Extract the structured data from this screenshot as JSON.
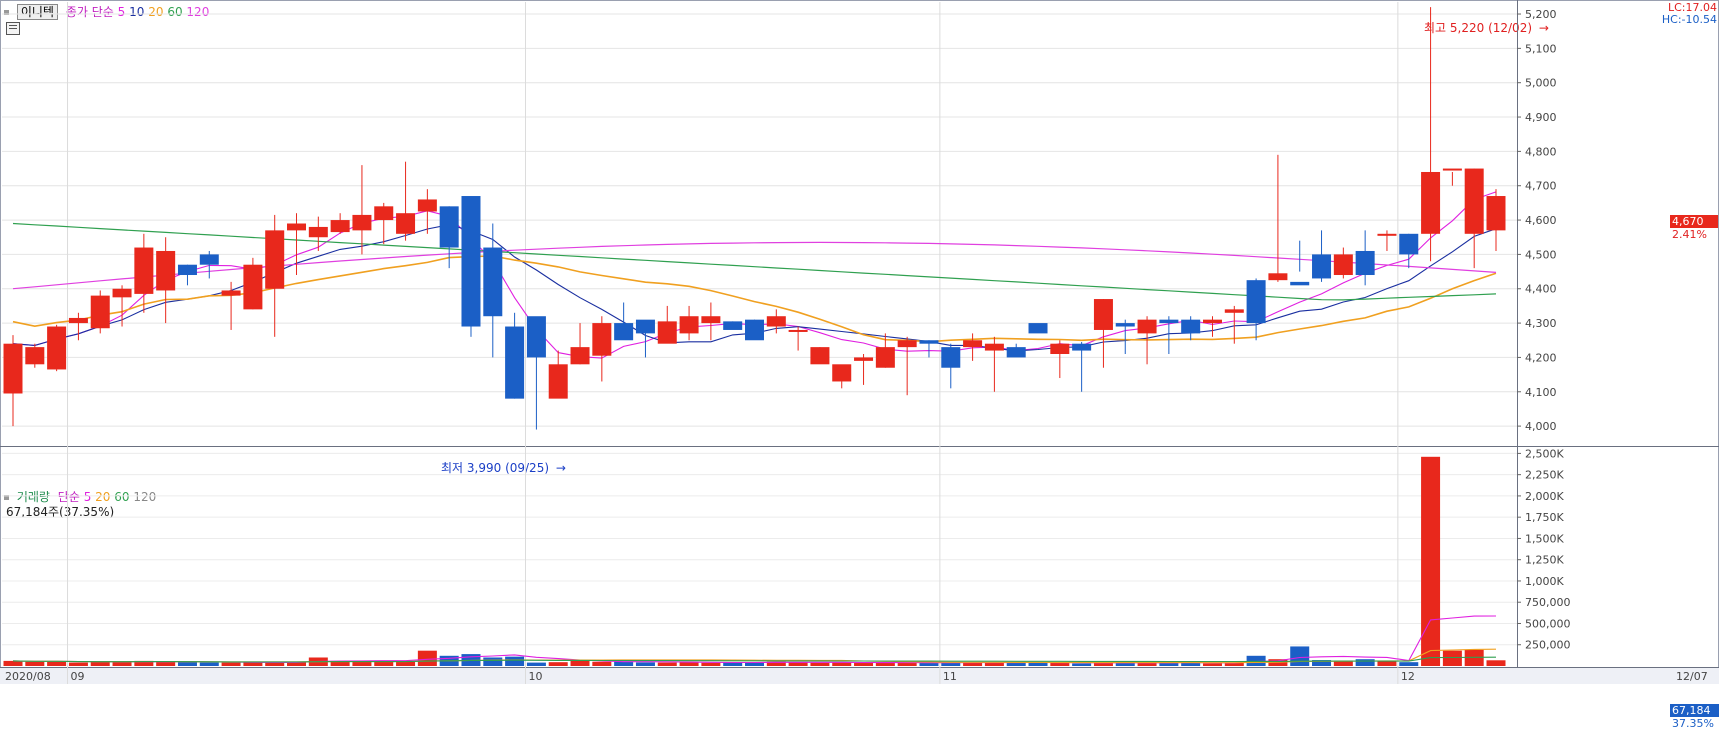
{
  "header": {
    "stock_name": "이니텍",
    "price_label": "종가",
    "ma_label": "단순",
    "ma_periods": [
      "5",
      "10",
      "20",
      "60",
      "120"
    ],
    "lc": "LC:17.04",
    "hc": "HC:-10.54"
  },
  "volume_header": {
    "label": "거래량",
    "ma_label": "단순",
    "ma_periods": [
      "5",
      "20",
      "60",
      "120"
    ],
    "current": "67,184주(37.35%)"
  },
  "annotations": {
    "high": "최고 5,220 (12/02)",
    "low": "최저 3,990 (09/25)"
  },
  "price_badge": {
    "value": "4,670",
    "change": "2.41%"
  },
  "volume_badge": {
    "value": "67,184",
    "ratio": "37.35%"
  },
  "x_labels": [
    "2020/08",
    "09",
    "10",
    "11",
    "12",
    "12/07"
  ],
  "colors": {
    "up": "#e8281c",
    "down": "#1b5fc6",
    "ma5": "#e020e0",
    "ma10": "#1a2fa0",
    "ma20": "#f0a020",
    "ma60": "#30a050",
    "ma120": "#e040e0"
  },
  "chart_data": [
    {
      "type": "candlestick",
      "title": "이니텍",
      "y_ticks": [
        "4,000",
        "4,100",
        "4,200",
        "4,300",
        "4,400",
        "4,500",
        "4,600",
        "4,700",
        "4,800",
        "4,900",
        "5,000",
        "5,100",
        "5,200"
      ],
      "ylim": [
        3945,
        5235
      ],
      "dates": [
        "08/27",
        "08/28",
        "08/31",
        "09/01",
        "09/02",
        "09/03",
        "09/04",
        "09/07",
        "09/08",
        "09/09",
        "09/10",
        "09/11",
        "09/14",
        "09/15",
        "09/16",
        "09/17",
        "09/18",
        "09/21",
        "09/22",
        "09/23",
        "09/24",
        "09/25",
        "09/28",
        "09/29",
        "10/05",
        "10/06",
        "10/07",
        "10/08",
        "10/12",
        "10/13",
        "10/14",
        "10/15",
        "10/16",
        "10/19",
        "10/20",
        "10/21",
        "10/22",
        "10/23",
        "10/26",
        "10/27",
        "10/28",
        "10/29",
        "10/30",
        "11/02",
        "11/03",
        "11/04",
        "11/05",
        "11/06",
        "11/09",
        "11/10",
        "11/11",
        "11/12",
        "11/13",
        "11/16",
        "11/17",
        "11/18",
        "11/19",
        "11/20",
        "11/23",
        "11/24",
        "11/25",
        "11/26",
        "11/27",
        "11/30",
        "12/01",
        "12/02",
        "12/03",
        "12/04",
        "12/07"
      ],
      "open": [
        4095,
        4180,
        4165,
        4300,
        4285,
        4375,
        4385,
        4395,
        4470,
        4500,
        4380,
        4340,
        4400,
        4570,
        4550,
        4565,
        4570,
        4600,
        4560,
        4625,
        4640,
        4670,
        4520,
        4290,
        4320,
        4080,
        4180,
        4205,
        4300,
        4310,
        4240,
        4270,
        4300,
        4305,
        4310,
        4290,
        4275,
        4180,
        4130,
        4190,
        4170,
        4230,
        4250,
        4230,
        4230,
        4220,
        4230,
        4300,
        4210,
        4240,
        4280,
        4300,
        4270,
        4310,
        4310,
        4300,
        4330,
        4425,
        4425,
        4420,
        4500,
        4440,
        4510,
        4560,
        4560,
        4560,
        4745,
        4560,
        4570
      ],
      "close": [
        4240,
        4230,
        4290,
        4315,
        4380,
        4400,
        4520,
        4510,
        4440,
        4470,
        4395,
        4470,
        4570,
        4590,
        4580,
        4600,
        4615,
        4640,
        4620,
        4660,
        4520,
        4290,
        4320,
        4080,
        4200,
        4180,
        4230,
        4300,
        4250,
        4270,
        4305,
        4320,
        4320,
        4280,
        4250,
        4320,
        4280,
        4230,
        4180,
        4200,
        4230,
        4250,
        4240,
        4170,
        4250,
        4240,
        4200,
        4270,
        4240,
        4220,
        4370,
        4290,
        4310,
        4300,
        4270,
        4310,
        4340,
        4300,
        4445,
        4410,
        4430,
        4500,
        4440,
        4560,
        4500,
        4740,
        4750,
        4750,
        4670
      ],
      "high": [
        4265,
        4240,
        4295,
        4330,
        4395,
        4410,
        4560,
        4550,
        4470,
        4510,
        4420,
        4490,
        4615,
        4620,
        4610,
        4620,
        4760,
        4650,
        4770,
        4690,
        4640,
        4460,
        4590,
        4330,
        4210,
        4220,
        4300,
        4320,
        4360,
        4290,
        4350,
        4350,
        4360,
        4305,
        4310,
        4340,
        4290,
        4230,
        4130,
        4210,
        4270,
        4260,
        4250,
        4240,
        4270,
        4260,
        4240,
        4280,
        4250,
        4245,
        4370,
        4310,
        4320,
        4320,
        4320,
        4320,
        4350,
        4430,
        4790,
        4540,
        4570,
        4520,
        4570,
        4570,
        4560,
        5220,
        4740,
        4750,
        4690
      ],
      "low": [
        4000,
        4170,
        4160,
        4250,
        4270,
        4290,
        4330,
        4300,
        4410,
        4430,
        4280,
        4340,
        4260,
        4440,
        4510,
        4560,
        4500,
        4530,
        4540,
        4560,
        4460,
        4260,
        4200,
        4080,
        3990,
        4150,
        4180,
        4130,
        4290,
        4200,
        4300,
        4250,
        4250,
        4300,
        4270,
        4270,
        4220,
        4190,
        4110,
        4120,
        4170,
        4090,
        4200,
        4110,
        4190,
        4100,
        4210,
        4280,
        4140,
        4100,
        4170,
        4210,
        4180,
        4210,
        4250,
        4260,
        4240,
        4250,
        4420,
        4450,
        4420,
        4430,
        4410,
        4510,
        4460,
        4480,
        4700,
        4460,
        4510
      ]
    },
    {
      "type": "bar",
      "title": "거래량",
      "y_ticks": [
        "250,000",
        "500,000",
        "750,000",
        "1,000K",
        "1,250K",
        "1,500K",
        "1,750K",
        "2,000K",
        "2,250K",
        "2,500K"
      ],
      "ylim": [
        0,
        2540000
      ],
      "values": [
        60000,
        50000,
        55000,
        40000,
        50000,
        45000,
        60000,
        50000,
        45000,
        40000,
        40000,
        45000,
        42000,
        45000,
        100000,
        60000,
        50000,
        55000,
        48000,
        180000,
        120000,
        140000,
        100000,
        110000,
        40000,
        45000,
        60000,
        50000,
        55000,
        42000,
        40000,
        45000,
        38000,
        40000,
        42000,
        50000,
        45000,
        38000,
        40000,
        35000,
        40000,
        45000,
        35000,
        40000,
        38000,
        42000,
        45000,
        40000,
        35000,
        30000,
        40000,
        45000,
        38000,
        35000,
        40000,
        30000,
        38000,
        120000,
        80000,
        230000,
        70000,
        65000,
        80000,
        60000,
        45000,
        2460000,
        180000,
        190000,
        67184
      ]
    }
  ]
}
